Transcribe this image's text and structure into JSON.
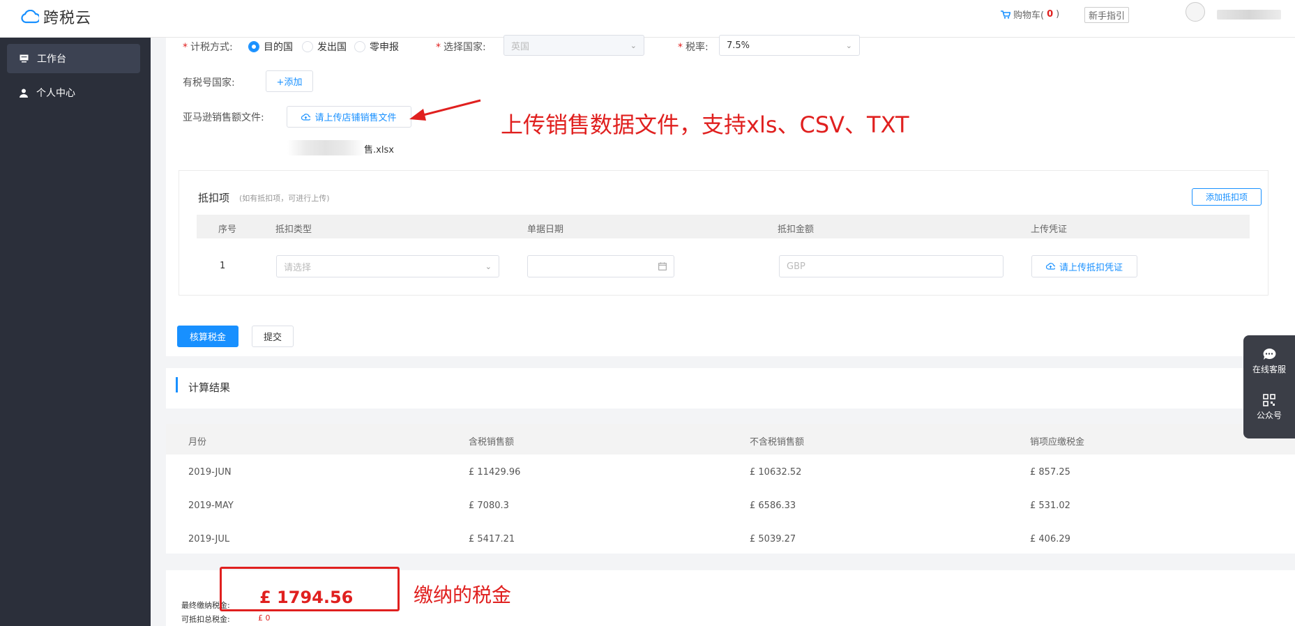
{
  "header": {
    "logo_text": "跨税云",
    "cart_label": "购物车(",
    "cart_count": "0",
    "cart_close": ")",
    "guide_label": "新手指引"
  },
  "sidebar": {
    "items": [
      {
        "label": "工作台",
        "icon": "monitor-icon"
      },
      {
        "label": "个人中心",
        "icon": "user-icon"
      }
    ]
  },
  "form": {
    "tax_method_label": "计税方式:",
    "tax_method_options": [
      "目的国",
      "发出国",
      "零申报"
    ],
    "tax_method_selected": "目的国",
    "country_label": "选择国家:",
    "country_value": "英国",
    "rate_label": "税率:",
    "rate_value": "7.5%",
    "tax_number_label": "有税号国家:",
    "add_button": "+添加",
    "sales_file_label": "亚马逊销售额文件:",
    "upload_button": "请上传店铺销售文件",
    "file_name_suffix": "售.xlsx"
  },
  "annotations": {
    "upload_note": "上传销售数据文件，支持xls、CSV、TXT",
    "tax_note": "缴纳的税金"
  },
  "deduction": {
    "title": "抵扣项",
    "hint": "(如有抵扣项，可进行上传)",
    "add_button": "添加抵扣项",
    "columns": [
      "序号",
      "抵扣类型",
      "单据日期",
      "抵扣金额",
      "上传凭证"
    ],
    "row": {
      "index": "1",
      "type_placeholder": "请选择",
      "amount_placeholder": "GBP",
      "upload_button": "请上传抵扣凭证"
    }
  },
  "actions": {
    "calc_button": "核算税金",
    "submit_button": "提交"
  },
  "result": {
    "title": "计算结果",
    "columns": [
      "月份",
      "含税销售额",
      "不含税销售额",
      "销项应缴税金"
    ],
    "rows": [
      [
        "2019-JUN",
        "£ 11429.96",
        "£ 10632.52",
        "£ 857.25"
      ],
      [
        "2019-MAY",
        "£ 7080.3",
        "£ 6586.33",
        "£ 531.02"
      ],
      [
        "2019-JUL",
        "£ 5417.21",
        "£ 5039.27",
        "£ 406.29"
      ]
    ]
  },
  "final": {
    "final_tax_label": "最终缴纳税金:",
    "final_tax_value": "£ 1794.56",
    "deduct_total_label": "可抵扣总税金:",
    "deduct_total_value": "£ 0"
  },
  "widget": {
    "chat_label": "在线客服",
    "wechat_label": "公众号"
  },
  "colors": {
    "primary": "#1890ff",
    "annotation_red": "#e0201f",
    "sidebar_bg": "#2b2f3a"
  }
}
